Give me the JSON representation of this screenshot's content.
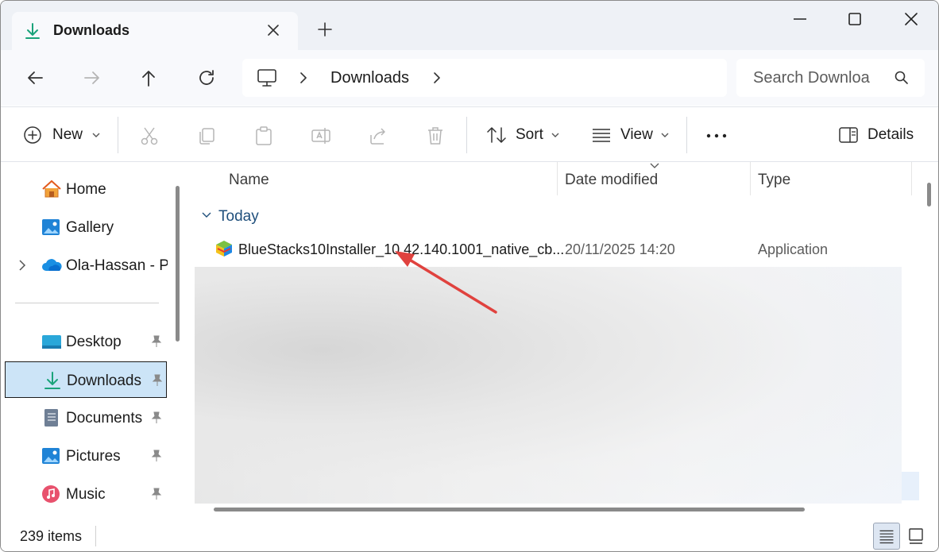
{
  "tab": {
    "title": "Downloads"
  },
  "address": {
    "crumb": "Downloads"
  },
  "search": {
    "placeholder": "Search Downloa"
  },
  "toolbar": {
    "new_label": "New",
    "sort_label": "Sort",
    "view_label": "View",
    "details_label": "Details"
  },
  "nav": {
    "items": [
      {
        "label": "Home",
        "icon": "home-icon"
      },
      {
        "label": "Gallery",
        "icon": "gallery-icon"
      },
      {
        "label": "Ola-Hassan - Pe",
        "icon": "onedrive-icon"
      },
      {
        "label": "Desktop",
        "icon": "desktop-icon",
        "pinned": true
      },
      {
        "label": "Downloads",
        "icon": "download-icon",
        "pinned": true,
        "selected": true
      },
      {
        "label": "Documents",
        "icon": "documents-icon",
        "pinned": true
      },
      {
        "label": "Pictures",
        "icon": "pictures-icon",
        "pinned": true
      },
      {
        "label": "Music",
        "icon": "music-icon",
        "pinned": true
      }
    ]
  },
  "columns": {
    "name": "Name",
    "date": "Date modified",
    "type": "Type"
  },
  "group": {
    "label": "Today"
  },
  "files": [
    {
      "name": "BlueStacks10Installer_10.42.140.1001_native_cb...",
      "date": "20/11/2025 14:20",
      "type": "Application"
    }
  ],
  "status": {
    "count": "239 items"
  },
  "colors": {
    "accent": "#0067c0",
    "selected_bg": "#cce4f7",
    "annotation_arrow": "#e0423e",
    "download_green": "#1aa37a"
  }
}
